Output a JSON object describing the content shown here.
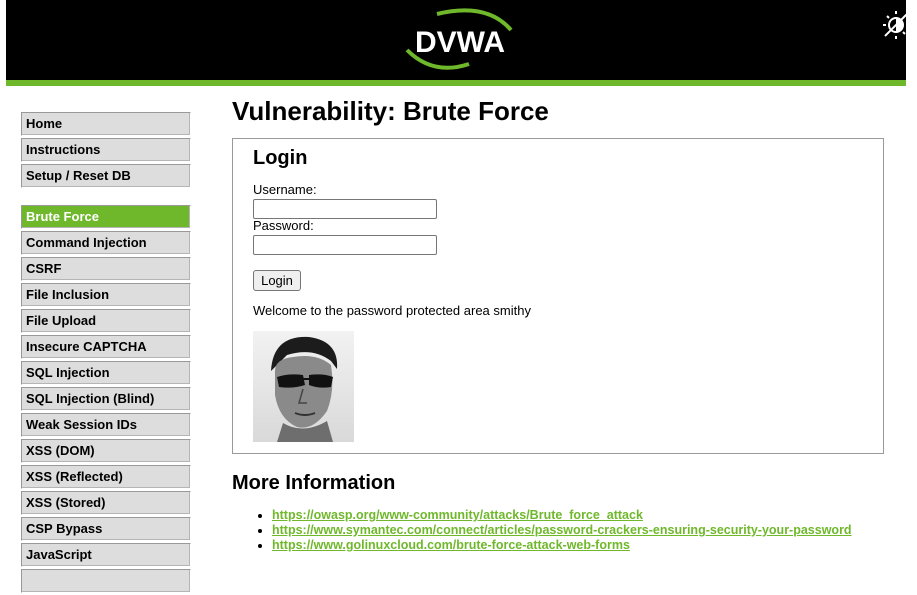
{
  "header": {
    "logo_text": "DVWA",
    "theme_toggle_icon": "theme-toggle-icon",
    "colors": {
      "background": "#000000",
      "accent": "#6fb82b"
    }
  },
  "sidebar": {
    "groups": [
      {
        "items": [
          {
            "label": "Home",
            "selected": false
          },
          {
            "label": "Instructions",
            "selected": false
          },
          {
            "label": "Setup / Reset DB",
            "selected": false
          }
        ]
      },
      {
        "items": [
          {
            "label": "Brute Force",
            "selected": true
          },
          {
            "label": "Command Injection",
            "selected": false
          },
          {
            "label": "CSRF",
            "selected": false
          },
          {
            "label": "File Inclusion",
            "selected": false
          },
          {
            "label": "File Upload",
            "selected": false
          },
          {
            "label": "Insecure CAPTCHA",
            "selected": false
          },
          {
            "label": "SQL Injection",
            "selected": false
          },
          {
            "label": "SQL Injection (Blind)",
            "selected": false
          },
          {
            "label": "Weak Session IDs",
            "selected": false
          },
          {
            "label": "XSS (DOM)",
            "selected": false
          },
          {
            "label": "XSS (Reflected)",
            "selected": false
          },
          {
            "label": "XSS (Stored)",
            "selected": false
          },
          {
            "label": "CSP Bypass",
            "selected": false
          },
          {
            "label": "JavaScript",
            "selected": false
          },
          {
            "label": "",
            "selected": false
          }
        ]
      }
    ]
  },
  "main": {
    "title": "Vulnerability: Brute Force",
    "login": {
      "heading": "Login",
      "username_label": "Username:",
      "username_value": "",
      "password_label": "Password:",
      "password_value": "",
      "button_label": "Login"
    },
    "welcome_text": "Welcome to the password protected area smithy",
    "avatar_icon": "user-photo"
  },
  "more_info": {
    "heading": "More Information",
    "links": [
      "https://owasp.org/www-community/attacks/Brute_force_attack",
      "https://www.symantec.com/connect/articles/password-crackers-ensuring-security-your-password",
      "https://www.golinuxcloud.com/brute-force-attack-web-forms"
    ]
  }
}
